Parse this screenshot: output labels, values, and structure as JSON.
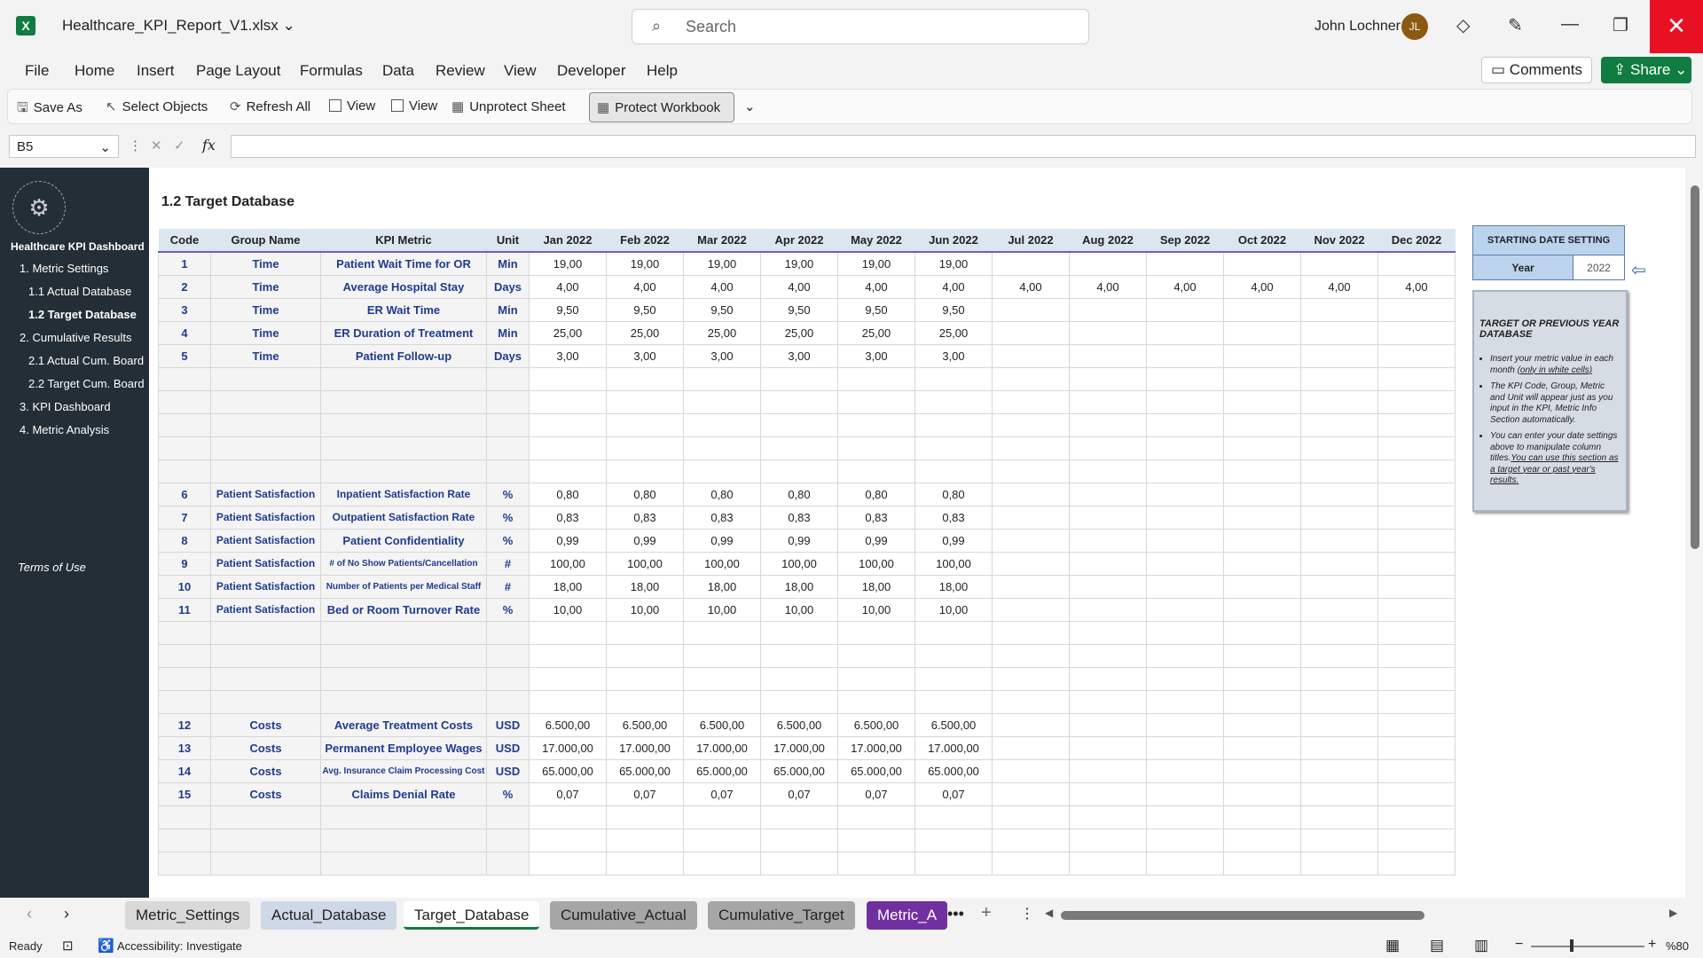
{
  "titlebar": {
    "app_icon": "excel-icon",
    "app_letter": "X",
    "filename": "Healthcare_KPI_Report_V1.xlsx",
    "search_placeholder": "Search",
    "user": "John Lochner",
    "initials": "JL"
  },
  "menu": [
    "File",
    "Home",
    "Insert",
    "Page Layout",
    "Formulas",
    "Data",
    "Review",
    "View",
    "Developer",
    "Help"
  ],
  "actions": {
    "comments": "Comments",
    "share": "Share"
  },
  "qat": {
    "save_as": "Save As",
    "select_objects": "Select Objects",
    "refresh_all": "Refresh All",
    "view1": "View",
    "view2": "View",
    "unprotect": "Unprotect Sheet",
    "protect": "Protect Workbook"
  },
  "formula_bar": {
    "name_box": "B5",
    "fx": "fx"
  },
  "sidebar": {
    "title": "Healthcare KPI Dashboard",
    "items": [
      "1. Metric Settings",
      "1.1 Actual Database",
      "1.2 Target Database",
      "2. Cumulative Results",
      "2.1 Actual Cum. Board",
      "2.2 Target Cum. Board",
      "3. KPI Dashboard",
      "4. Metric Analysis"
    ],
    "terms": "Terms of Use"
  },
  "sheet": {
    "title": "1.2 Target Database",
    "headers": [
      "Code",
      "Group Name",
      "KPI Metric",
      "Unit",
      "Jan 2022",
      "Feb 2022",
      "Mar 2022",
      "Apr 2022",
      "May 2022",
      "Jun 2022",
      "Jul 2022",
      "Aug 2022",
      "Sep 2022",
      "Oct 2022",
      "Nov 2022",
      "Dec 2022"
    ],
    "rows": [
      [
        "1",
        "Time",
        "Patient Wait Time for OR",
        "Min",
        "19,00",
        "19,00",
        "19,00",
        "19,00",
        "19,00",
        "19,00",
        "",
        "",
        "",
        "",
        "",
        ""
      ],
      [
        "2",
        "Time",
        "Average Hospital Stay",
        "Days",
        "4,00",
        "4,00",
        "4,00",
        "4,00",
        "4,00",
        "4,00",
        "4,00",
        "4,00",
        "4,00",
        "4,00",
        "4,00",
        "4,00"
      ],
      [
        "3",
        "Time",
        "ER Wait Time",
        "Min",
        "9,50",
        "9,50",
        "9,50",
        "9,50",
        "9,50",
        "9,50",
        "",
        "",
        "",
        "",
        "",
        ""
      ],
      [
        "4",
        "Time",
        "ER Duration of Treatment",
        "Min",
        "25,00",
        "25,00",
        "25,00",
        "25,00",
        "25,00",
        "25,00",
        "",
        "",
        "",
        "",
        "",
        ""
      ],
      [
        "5",
        "Time",
        "Patient Follow-up",
        "Days",
        "3,00",
        "3,00",
        "3,00",
        "3,00",
        "3,00",
        "3,00",
        "",
        "",
        "",
        "",
        "",
        ""
      ],
      [],
      [],
      [],
      [],
      [],
      [
        "6",
        "Patient Satisfaction",
        "Inpatient Satisfaction Rate",
        "%",
        "0,80",
        "0,80",
        "0,80",
        "0,80",
        "0,80",
        "0,80",
        "",
        "",
        "",
        "",
        "",
        ""
      ],
      [
        "7",
        "Patient Satisfaction",
        "Outpatient Satisfaction Rate",
        "%",
        "0,83",
        "0,83",
        "0,83",
        "0,83",
        "0,83",
        "0,83",
        "",
        "",
        "",
        "",
        "",
        ""
      ],
      [
        "8",
        "Patient Satisfaction",
        "Patient Confidentiality",
        "%",
        "0,99",
        "0,99",
        "0,99",
        "0,99",
        "0,99",
        "0,99",
        "",
        "",
        "",
        "",
        "",
        ""
      ],
      [
        "9",
        "Patient Satisfaction",
        "# of No Show Patients/Cancellation",
        "#",
        "100,00",
        "100,00",
        "100,00",
        "100,00",
        "100,00",
        "100,00",
        "",
        "",
        "",
        "",
        "",
        ""
      ],
      [
        "10",
        "Patient Satisfaction",
        "Number of Patients per Medical Staff",
        "#",
        "18,00",
        "18,00",
        "18,00",
        "18,00",
        "18,00",
        "18,00",
        "",
        "",
        "",
        "",
        "",
        ""
      ],
      [
        "11",
        "Patient Satisfaction",
        "Bed or Room Turnover Rate",
        "%",
        "10,00",
        "10,00",
        "10,00",
        "10,00",
        "10,00",
        "10,00",
        "",
        "",
        "",
        "",
        "",
        ""
      ],
      [],
      [],
      [],
      [],
      [
        "12",
        "Costs",
        "Average Treatment Costs",
        "USD",
        "6.500,00",
        "6.500,00",
        "6.500,00",
        "6.500,00",
        "6.500,00",
        "6.500,00",
        "",
        "",
        "",
        "",
        "",
        ""
      ],
      [
        "13",
        "Costs",
        "Permanent Employee Wages",
        "USD",
        "17.000,00",
        "17.000,00",
        "17.000,00",
        "17.000,00",
        "17.000,00",
        "17.000,00",
        "",
        "",
        "",
        "",
        "",
        ""
      ],
      [
        "14",
        "Costs",
        "Avg. Insurance Claim Processing Cost",
        "USD",
        "65.000,00",
        "65.000,00",
        "65.000,00",
        "65.000,00",
        "65.000,00",
        "65.000,00",
        "",
        "",
        "",
        "",
        "",
        ""
      ],
      [
        "15",
        "Costs",
        "Claims Denial Rate",
        "%",
        "0,07",
        "0,07",
        "0,07",
        "0,07",
        "0,07",
        "0,07",
        "",
        "",
        "",
        "",
        "",
        ""
      ],
      [],
      [],
      []
    ]
  },
  "date_setting": {
    "header": "STARTING DATE SETTING",
    "label": "Year",
    "value": "2022"
  },
  "note": {
    "title": "TARGET OR PREVIOUS YEAR DATABASE",
    "b1": "Insert your metric value in each month ",
    "b1u": "(only in white cells)",
    "b2": "The KPI Code, Group, Metric and Unit will appear just as you input in the KPI, Metric Info Section automatically.",
    "b3": "You can enter your date settings above to manipulate column titles.",
    "b3u": "You can use this section as a target year or past year's results."
  },
  "tabs": [
    "Metric_Settings",
    "Actual_Database",
    "Target_Database",
    "Cumulative_Actual",
    "Cumulative_Target",
    "Metric_A"
  ],
  "status": {
    "ready": "Ready",
    "accessibility": "Accessibility: Investigate",
    "zoom": "%80"
  }
}
